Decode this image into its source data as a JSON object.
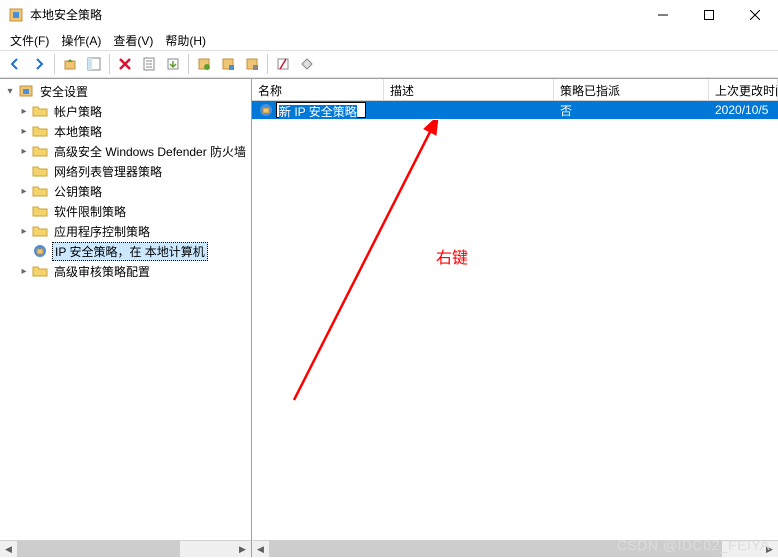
{
  "window": {
    "title": "本地安全策略"
  },
  "menu": {
    "file": "文件(F)",
    "action": "操作(A)",
    "view": "查看(V)",
    "help": "帮助(H)"
  },
  "tree": {
    "root": "安全设置",
    "items": [
      {
        "label": "帐户策略",
        "expandable": true
      },
      {
        "label": "本地策略",
        "expandable": true
      },
      {
        "label": "高级安全 Windows Defender 防火墙",
        "expandable": true
      },
      {
        "label": "网络列表管理器策略",
        "expandable": false
      },
      {
        "label": "公钥策略",
        "expandable": true
      },
      {
        "label": "软件限制策略",
        "expandable": false
      },
      {
        "label": "应用程序控制策略",
        "expandable": true
      },
      {
        "label": "IP 安全策略，在 本地计算机",
        "expandable": false,
        "selected": true,
        "icon": "ip"
      },
      {
        "label": "高级审核策略配置",
        "expandable": true
      }
    ]
  },
  "list": {
    "columns": {
      "name": "名称",
      "desc": "描述",
      "assigned": "策略已指派",
      "modified": "上次更改时间"
    },
    "rows": [
      {
        "name": "新 IP 安全策略",
        "desc": "",
        "assigned": "否",
        "modified": "2020/10/5",
        "editing": true
      }
    ]
  },
  "annotation": {
    "text": "右键"
  },
  "watermark": "CSDN @IDC02_FEIYA"
}
